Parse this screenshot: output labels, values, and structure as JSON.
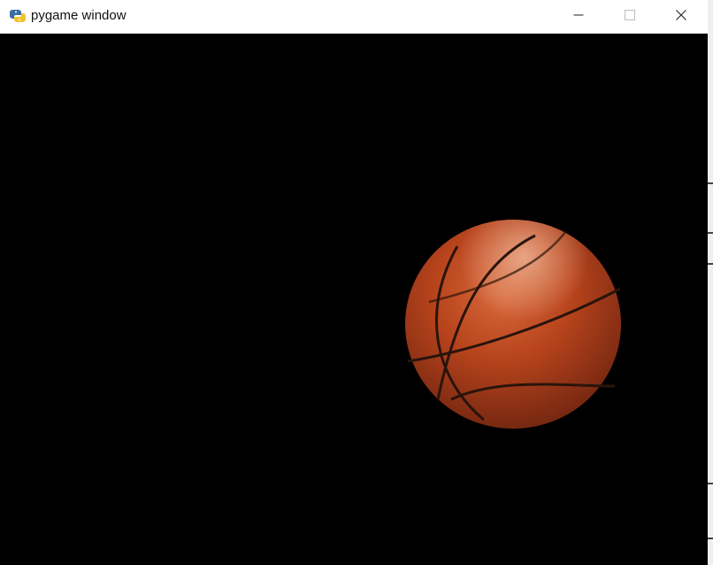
{
  "window": {
    "title": "pygame window",
    "icon": "python-snake-icon",
    "controls": [
      "minimize-icon",
      "maximize-icon",
      "close-icon"
    ]
  },
  "canvas": {
    "background": "#000000",
    "sprite": "basketball",
    "ball_color": "#b8441c",
    "seam_color": "#2a140c"
  }
}
